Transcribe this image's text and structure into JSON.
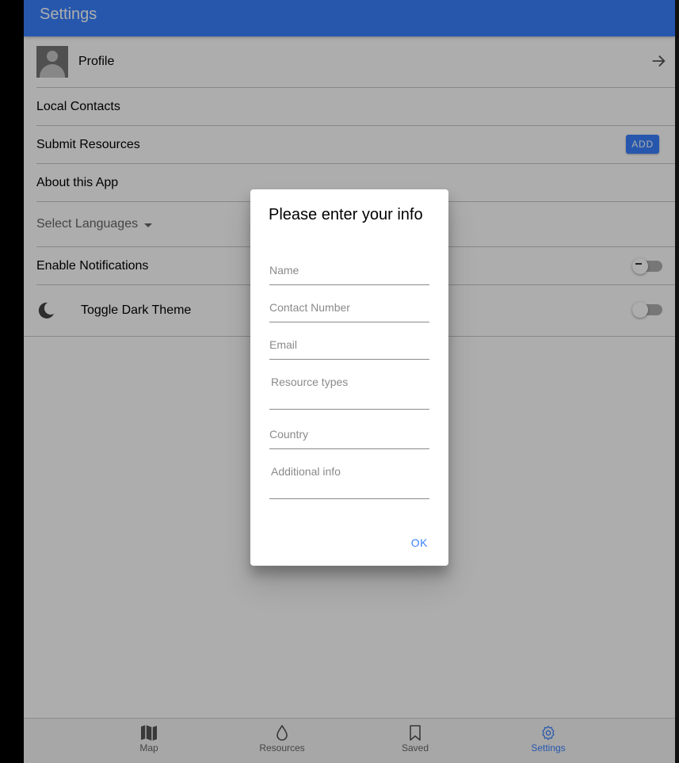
{
  "header": {
    "title": "Settings"
  },
  "settings": {
    "profile_label": "Profile",
    "local_contacts_label": "Local Contacts",
    "submit_resources_label": "Submit Resources",
    "add_button_label": "ADD",
    "about_label": "About this App",
    "select_languages_label": "Select Languages",
    "enable_notifications_label": "Enable Notifications",
    "enable_notifications_on": false,
    "dark_theme_label": "Toggle Dark Theme",
    "dark_theme_on": false
  },
  "dialog": {
    "title": "Please enter your info",
    "name_placeholder": "Name",
    "contact_placeholder": "Contact Number",
    "email_placeholder": "Email",
    "resource_types_placeholder": "Resource types",
    "country_placeholder": "Country",
    "additional_info_placeholder": "Additional info",
    "ok_label": "OK"
  },
  "tabs": [
    {
      "label": "Map",
      "icon": "map-icon"
    },
    {
      "label": "Resources",
      "icon": "water-drop-icon"
    },
    {
      "label": "Saved",
      "icon": "bookmark-icon"
    },
    {
      "label": "Settings",
      "icon": "gear-icon",
      "active": true
    }
  ],
  "colors": {
    "primary": "#3880ff",
    "backdrop": "rgba(0,0,0,0.32)"
  }
}
